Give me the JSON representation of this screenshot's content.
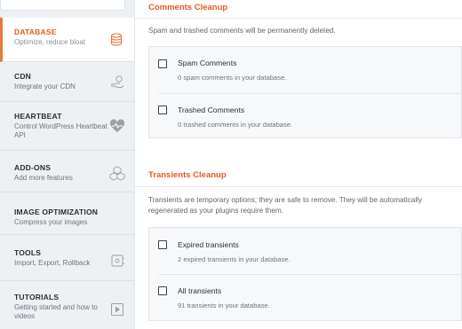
{
  "sidebar": {
    "items": [
      {
        "title": "DATABASE",
        "subtitle": "Optimize, reduce bloat",
        "icon": "database-icon",
        "active": true
      },
      {
        "title": "CDN",
        "subtitle": "Integrate your CDN",
        "icon": "cdn-hand-icon"
      },
      {
        "title": "HEARTBEAT",
        "subtitle": "Control WordPress Heartbeat API",
        "icon": "heartbeat-icon"
      },
      {
        "title": "ADD-ONS",
        "subtitle": "Add more features",
        "icon": "cubes-icon"
      },
      {
        "title": "IMAGE OPTIMIZATION",
        "subtitle": "Compress your images",
        "icon": ""
      },
      {
        "title": "TOOLS",
        "subtitle": "Import, Export, Rollback",
        "icon": "tools-icon"
      },
      {
        "title": "TUTORIALS",
        "subtitle": "Getting started and how to videos",
        "icon": "play-icon"
      }
    ]
  },
  "comments": {
    "title": "Comments Cleanup",
    "description": "Spam and trashed comments will be permanently deleted.",
    "options": [
      {
        "label": "Spam Comments",
        "detail": "0 spam comments in your database."
      },
      {
        "label": "Trashed Comments",
        "detail": "0 trashed comments in your database."
      }
    ]
  },
  "transients": {
    "title": "Transients Cleanup",
    "description": "Transients are temporary options; they are safe to remove. They will be automatically regenerated as your plugins require them.",
    "options": [
      {
        "label": "Expired transients",
        "detail": "2 expired transients in your database."
      },
      {
        "label": "All transients",
        "detail": "91 transients in your database."
      }
    ]
  },
  "colors": {
    "accent": "#e05b23",
    "sidebar_bg": "#eef1f4"
  }
}
